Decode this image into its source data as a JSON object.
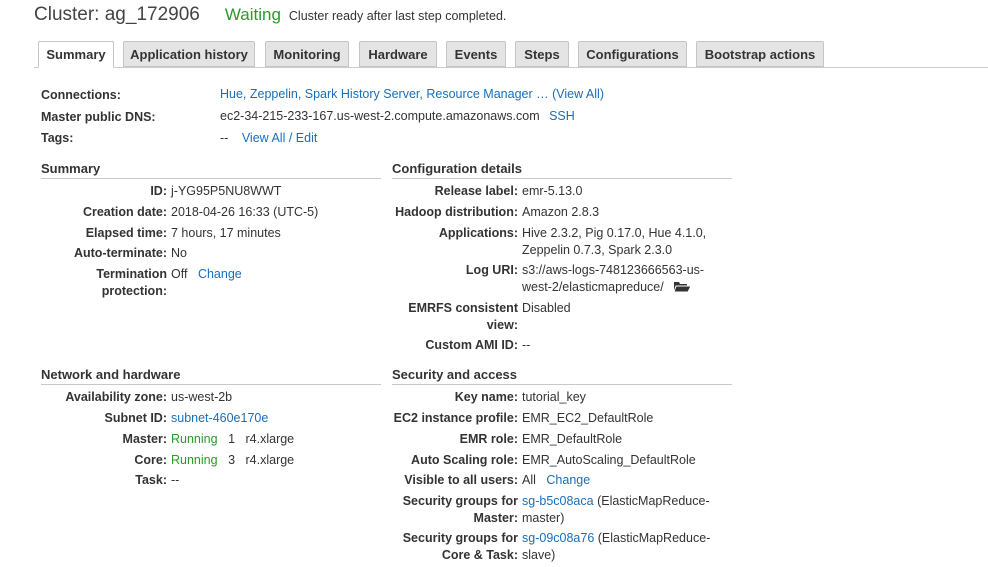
{
  "header": {
    "title": "Cluster: ag_172906",
    "state": "Waiting",
    "state_message": "Cluster ready after last step completed."
  },
  "tabs": [
    {
      "label": "Summary"
    },
    {
      "label": "Application history"
    },
    {
      "label": "Monitoring"
    },
    {
      "label": "Hardware"
    },
    {
      "label": "Events"
    },
    {
      "label": "Steps"
    },
    {
      "label": "Configurations"
    },
    {
      "label": "Bootstrap actions"
    }
  ],
  "top": {
    "connections_label": "Connections:",
    "connections_value": "Hue, Zeppelin, Spark History Server, Resource Manager …",
    "view_all_link": "(View All)",
    "dns_label": "Master public DNS:",
    "dns_value": "ec2-34-215-233-167.us-west-2.compute.amazonaws.com",
    "ssh_link": "SSH",
    "tags_label": "Tags:",
    "tags_value": "--",
    "tags_link": "View All / Edit"
  },
  "summary": {
    "heading": "Summary",
    "id_label": "ID:",
    "id_value": "j-YG95P5NU8WWT",
    "creation_label": "Creation date:",
    "creation_value": "2018-04-26 16:33 (UTC-5)",
    "elapsed_label": "Elapsed time:",
    "elapsed_value": "7 hours, 17 minutes",
    "autoterm_label": "Auto-terminate:",
    "autoterm_value": "No",
    "termprot_label_1": "Termination",
    "termprot_label_2": "protection:",
    "termprot_value": "Off",
    "termprot_link": "Change"
  },
  "config": {
    "heading": "Configuration details",
    "release_label": "Release label:",
    "release_value": "emr-5.13.0",
    "hadoop_label": "Hadoop distribution:",
    "hadoop_value": "Amazon 2.8.3",
    "apps_label": "Applications:",
    "apps_value_1": "Hive 2.3.2, Pig 0.17.0, Hue 4.1.0,",
    "apps_value_2": "Zeppelin 0.7.3, Spark 2.3.0",
    "log_label": "Log URI:",
    "log_value_1": "s3://aws-logs-748123666563-us-",
    "log_value_2": "west-2/elasticmapreduce/",
    "emrfs_label_1": "EMRFS consistent",
    "emrfs_label_2": "view:",
    "emrfs_value": "Disabled",
    "ami_label": "Custom AMI ID:",
    "ami_value": "--"
  },
  "network": {
    "heading": "Network and hardware",
    "az_label": "Availability zone:",
    "az_value": "us-west-2b",
    "subnet_label": "Subnet ID:",
    "subnet_value": "subnet-460e170e",
    "master_label": "Master:",
    "master_status": "Running",
    "master_count": "1",
    "master_type": "r4.xlarge",
    "core_label": "Core:",
    "core_status": "Running",
    "core_count": "3",
    "core_type": "r4.xlarge",
    "task_label": "Task:",
    "task_value": "--"
  },
  "security": {
    "heading": "Security and access",
    "key_label": "Key name:",
    "key_value": "tutorial_key",
    "ec2_label": "EC2 instance profile:",
    "ec2_value": "EMR_EC2_DefaultRole",
    "emrrole_label": "EMR role:",
    "emrrole_value": "EMR_DefaultRole",
    "asrole_label": "Auto Scaling role:",
    "asrole_value": "EMR_AutoScaling_DefaultRole",
    "visible_label": "Visible to all users:",
    "visible_value": "All",
    "visible_link": "Change",
    "sgm_label_1": "Security groups for",
    "sgm_label_2": "Master:",
    "sgm_link": "sg-b5c08aca",
    "sgm_value_1": "(ElasticMapReduce-",
    "sgm_value_2": "master)",
    "sgc_label_1": "Security groups for",
    "sgc_label_2": "Core & Task:",
    "sgc_link": "sg-09c08a76",
    "sgc_value_1": "(ElasticMapReduce-",
    "sgc_value_2": "slave)"
  },
  "colors": {
    "link": "#1a6eb8",
    "running": "#2a9a2a",
    "tab_bg": "#e4e4e4"
  },
  "icons": {
    "log_folder": "folder-open-icon"
  }
}
